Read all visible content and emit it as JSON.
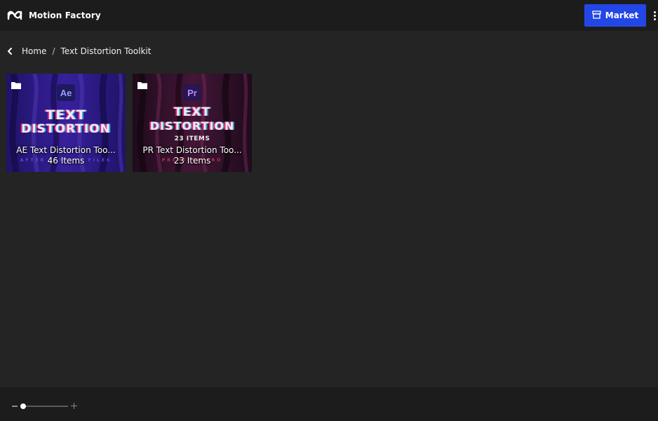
{
  "app": {
    "title": "Motion Factory",
    "logo_icon": "motion-factory-logo-icon"
  },
  "header": {
    "market_label": "Market",
    "market_icon": "store-icon",
    "more_icon": "more-vertical-icon",
    "accent_color": "#2347e6"
  },
  "breadcrumb": {
    "back_icon": "chevron-left-icon",
    "home": "Home",
    "separator": "/",
    "current": "Text Distortion Toolkit"
  },
  "folders": [
    {
      "badge": "Ae",
      "art_line1": "TEXT",
      "art_line2": "DISTORTION",
      "art_strip": "AFTER EFFECTS FILES",
      "title": "AE Text Distortion Too...",
      "count": "46 Items",
      "icon": "folder-icon"
    },
    {
      "badge": "Pr",
      "art_line1": "TEXT",
      "art_line2": "DISTORTION",
      "art_sub": "23 ITEMS",
      "art_strip": "PREMIERE PRO",
      "title": "PR Text Distortion Too...",
      "count": "23 Items",
      "icon": "folder-icon"
    }
  ],
  "footer": {
    "zoom_level": 0.05,
    "zoom_out_icon": "minus-icon",
    "zoom_in_icon": "plus-icon"
  }
}
